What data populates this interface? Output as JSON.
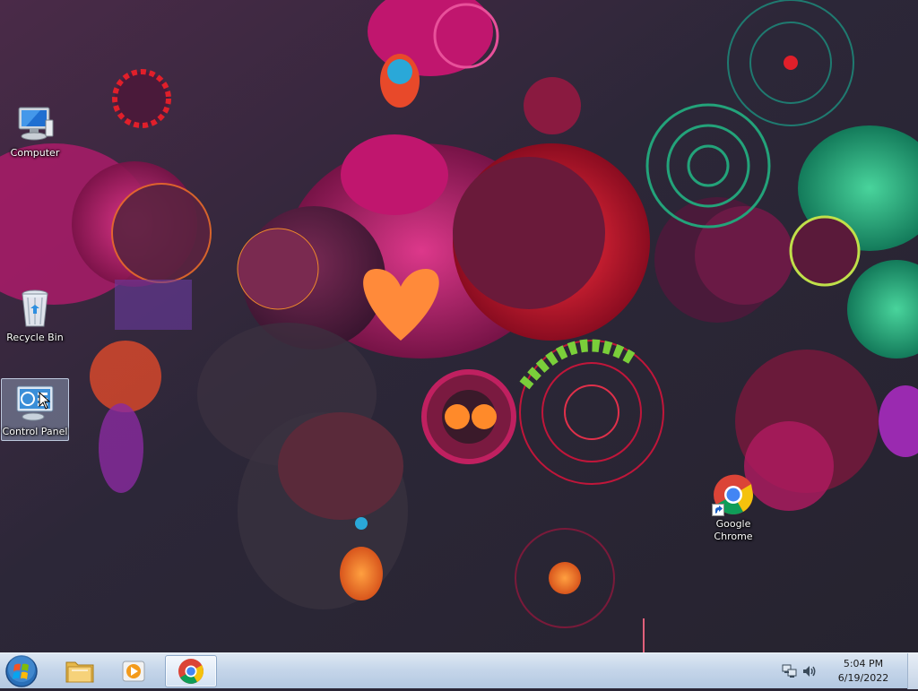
{
  "desktop": {
    "icons": [
      {
        "label": "Computer",
        "icon": "computer-icon"
      },
      {
        "label": "Recycle Bin",
        "icon": "recycle-bin-icon"
      },
      {
        "label": "Control Panel",
        "icon": "control-panel-icon"
      },
      {
        "label": "Google Chrome",
        "label_line1": "Google",
        "label_line2": "Chrome",
        "icon": "chrome-icon"
      }
    ]
  },
  "taskbar": {
    "start_icon": "windows-start-icon",
    "pinned": [
      {
        "icon": "file-explorer-icon"
      },
      {
        "icon": "media-player-icon"
      },
      {
        "icon": "chrome-icon",
        "active": true
      }
    ],
    "tray": {
      "network_icon": "network-icon",
      "volume_icon": "volume-icon",
      "time": "5:04 PM",
      "date": "6/19/2022"
    }
  },
  "colors": {
    "wallpaper_base": "#2a2535",
    "accent_magenta": "#d0117a",
    "accent_red": "#e01f2a",
    "accent_teal": "#23a37a",
    "taskbar": "#c6d6ea"
  }
}
